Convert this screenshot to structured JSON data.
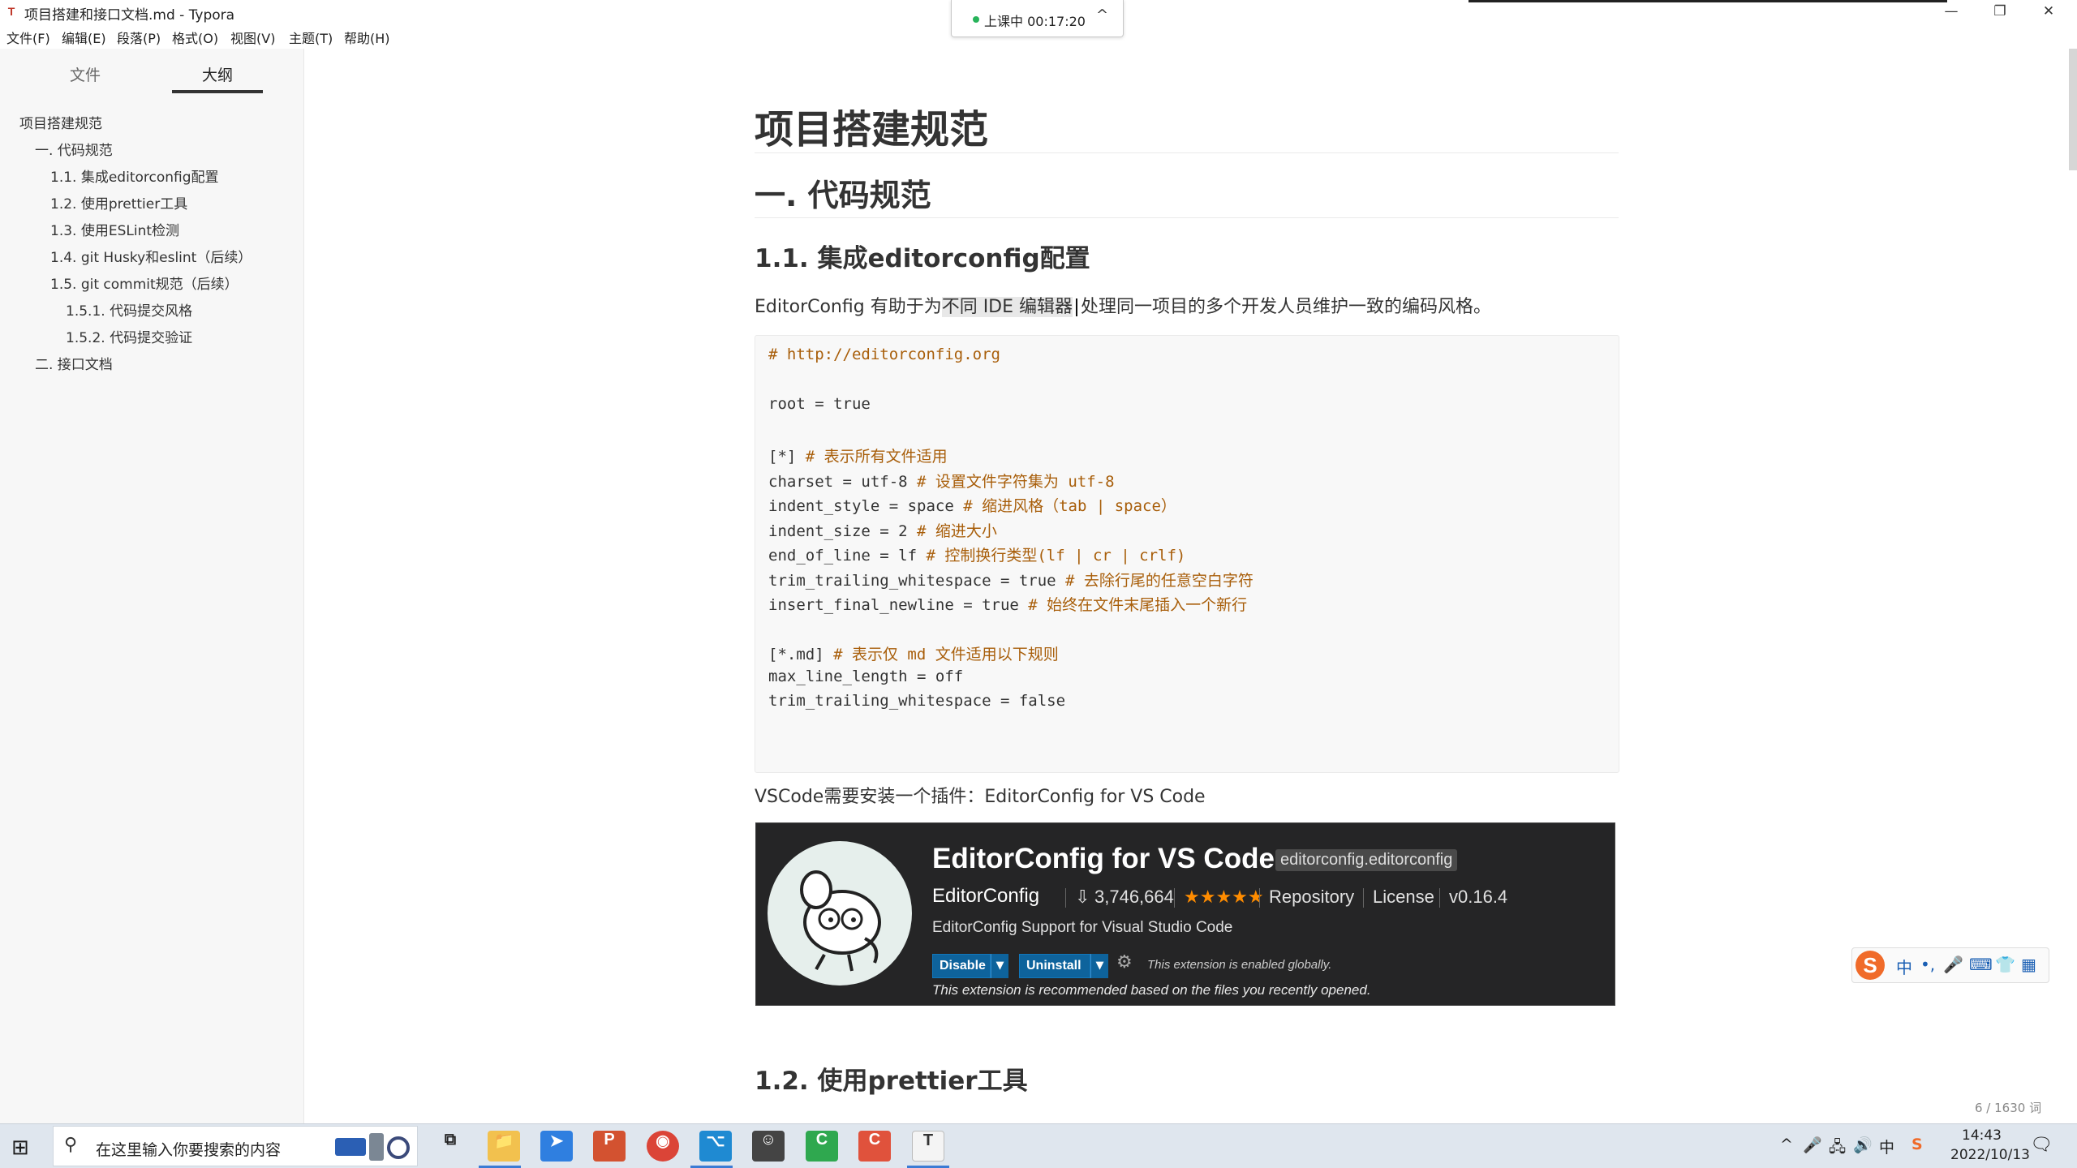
{
  "window": {
    "title": "项目搭建和接口文档.md - Typora",
    "app_icon": "T",
    "minimize": "—",
    "maximize": "❐",
    "close": "✕"
  },
  "menubar": [
    "文件(F)",
    "编辑(E)",
    "段落(P)",
    "格式(O)",
    "视图(V)",
    "主题(T)",
    "帮助(H)"
  ],
  "recording": {
    "status": "上课中 00:17:20",
    "chevron": "^"
  },
  "sidebar": {
    "tabs": [
      "文件",
      "大纲"
    ],
    "active_tab": "大纲",
    "outline": [
      {
        "level": 1,
        "text": "项目搭建规范"
      },
      {
        "level": 2,
        "text": "一. 代码规范"
      },
      {
        "level": 3,
        "text": "1.1. 集成editorconfig配置"
      },
      {
        "level": 3,
        "text": "1.2. 使用prettier工具"
      },
      {
        "level": 3,
        "text": "1.3. 使用ESLint检测"
      },
      {
        "level": 3,
        "text": "1.4. git Husky和eslint（后续）"
      },
      {
        "level": 3,
        "text": "1.5. git commit规范（后续）"
      },
      {
        "level": 4,
        "text": "1.5.1. 代码提交风格"
      },
      {
        "level": 4,
        "text": "1.5.2. 代码提交验证"
      },
      {
        "level": 2,
        "text": "二. 接口文档"
      }
    ],
    "bottom_buttons": [
      "<",
      "</>"
    ]
  },
  "document": {
    "h1": "项目搭建规范",
    "h2": "一. 代码规范",
    "h3_editorconfig": "1.1. 集成editorconfig配置",
    "intro": {
      "before": "EditorConfig 有助于为",
      "highlight": "不同 IDE 编辑器",
      "after": "处理同一项目的多个开发人员维护一致的编码风格。"
    },
    "code_lines": [
      {
        "code": "",
        "comment": "# http://editorconfig.org"
      },
      {
        "code": "",
        "comment": ""
      },
      {
        "code": "root = true",
        "comment": ""
      },
      {
        "code": "",
        "comment": ""
      },
      {
        "code": "[*] ",
        "comment": "# 表示所有文件适用"
      },
      {
        "code": "charset = utf-8 ",
        "comment": "# 设置文件字符集为 utf-8"
      },
      {
        "code": "indent_style = space ",
        "comment": "# 缩进风格（tab | space）"
      },
      {
        "code": "indent_size = 2 ",
        "comment": "# 缩进大小"
      },
      {
        "code": "end_of_line = lf ",
        "comment": "# 控制换行类型(lf | cr | crlf)"
      },
      {
        "code": "trim_trailing_whitespace = true ",
        "comment": "# 去除行尾的任意空白字符"
      },
      {
        "code": "insert_final_newline = true ",
        "comment": "# 始终在文件末尾插入一个新行"
      },
      {
        "code": "",
        "comment": ""
      },
      {
        "code": "[*.md] ",
        "comment": "# 表示仅 md 文件适用以下规则"
      },
      {
        "code": "max_line_length = off",
        "comment": ""
      },
      {
        "code": "trim_trailing_whitespace = false",
        "comment": ""
      }
    ],
    "vscode_note": "VSCode需要安装一个插件：EditorConfig for VS Code",
    "extension": {
      "name": "EditorConfig for VS Code",
      "id": "editorconfig.editorconfig",
      "publisher": "EditorConfig",
      "installs": "3,746,664",
      "stars": "★★★★★",
      "repository": "Repository",
      "license": "License",
      "version": "v0.16.4",
      "description": "EditorConfig Support for Visual Studio Code",
      "disable_label": "Disable",
      "uninstall_label": "Uninstall",
      "enabled_note": "This extension is enabled globally.",
      "recommended_note": "This extension is recommended based on the files you recently opened."
    },
    "h3_prettier": "1.2. 使用prettier工具",
    "word_count": "6 / 1630 词"
  },
  "ime": {
    "logo": "S",
    "items": [
      "中",
      "•,",
      "🎤",
      "⌨",
      "👕",
      "▦"
    ]
  },
  "taskbar": {
    "start_icon": "⊞",
    "search_placeholder": "在这里输入你要搜索的内容",
    "apps": [
      {
        "name": "task-view",
        "glyph": "⧉",
        "color": "#dfe6ee"
      },
      {
        "name": "file-explorer",
        "glyph": "📁",
        "color": "#f2c14e"
      },
      {
        "name": "feishu",
        "glyph": "➤",
        "color": "#2f7fe0"
      },
      {
        "name": "powerpoint",
        "glyph": "P",
        "color": "#d35230"
      },
      {
        "name": "chrome",
        "glyph": "◉",
        "color": "#db4437"
      },
      {
        "name": "vscode",
        "glyph": "⌥",
        "color": "#1f8ad2"
      },
      {
        "name": "avatar-app",
        "glyph": "☺",
        "color": "#444444"
      },
      {
        "name": "green-app",
        "glyph": "C",
        "color": "#2fa84f"
      },
      {
        "name": "red-app",
        "glyph": "C",
        "color": "#e0523c"
      },
      {
        "name": "typora",
        "glyph": "T",
        "color": "#f4f4f4"
      }
    ],
    "tray": [
      "^",
      "🎤",
      "🖧",
      "🔊",
      "中",
      "S"
    ],
    "time": "14:43",
    "date": "2022/10/13",
    "notification_icon": "🗨"
  },
  "colors": {
    "code_comment": "#a85e0a",
    "extension_bg": "#252526",
    "extension_button": "#0e639c",
    "star": "#ff8c00",
    "ime_logo": "#f06b2a"
  }
}
